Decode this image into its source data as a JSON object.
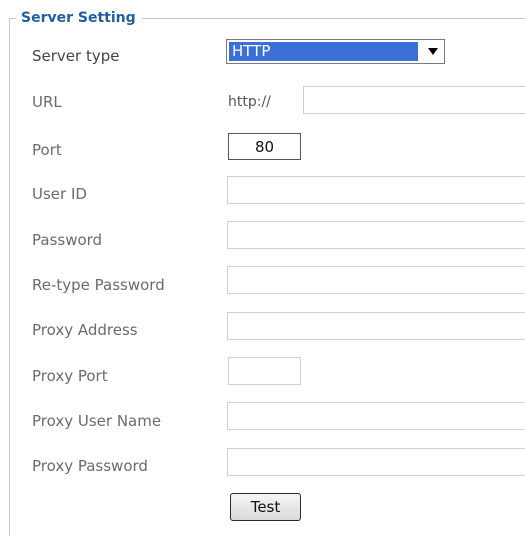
{
  "section": {
    "title": "Server Setting"
  },
  "server_type": {
    "label": "Server type",
    "selected": "HTTP"
  },
  "url": {
    "label": "URL",
    "prefix": "http://",
    "value": ""
  },
  "port": {
    "label": "Port",
    "value": "80"
  },
  "user_id": {
    "label": "User ID",
    "value": ""
  },
  "password": {
    "label": "Password",
    "value": ""
  },
  "retype_password": {
    "label": "Re-type Password",
    "value": ""
  },
  "proxy_address": {
    "label": "Proxy Address",
    "value": ""
  },
  "proxy_port": {
    "label": "Proxy Port",
    "value": ""
  },
  "proxy_user_name": {
    "label": "Proxy User Name",
    "value": ""
  },
  "proxy_password": {
    "label": "Proxy Password",
    "value": ""
  },
  "test_button": {
    "label": "Test"
  },
  "colors": {
    "section_title": "#1f5f9f",
    "selection_highlight": "#3a70d8",
    "label_text": "#6b6b6b",
    "field_border": "#cfcfcf"
  },
  "icons": {
    "dropdown": "triangle-down"
  }
}
